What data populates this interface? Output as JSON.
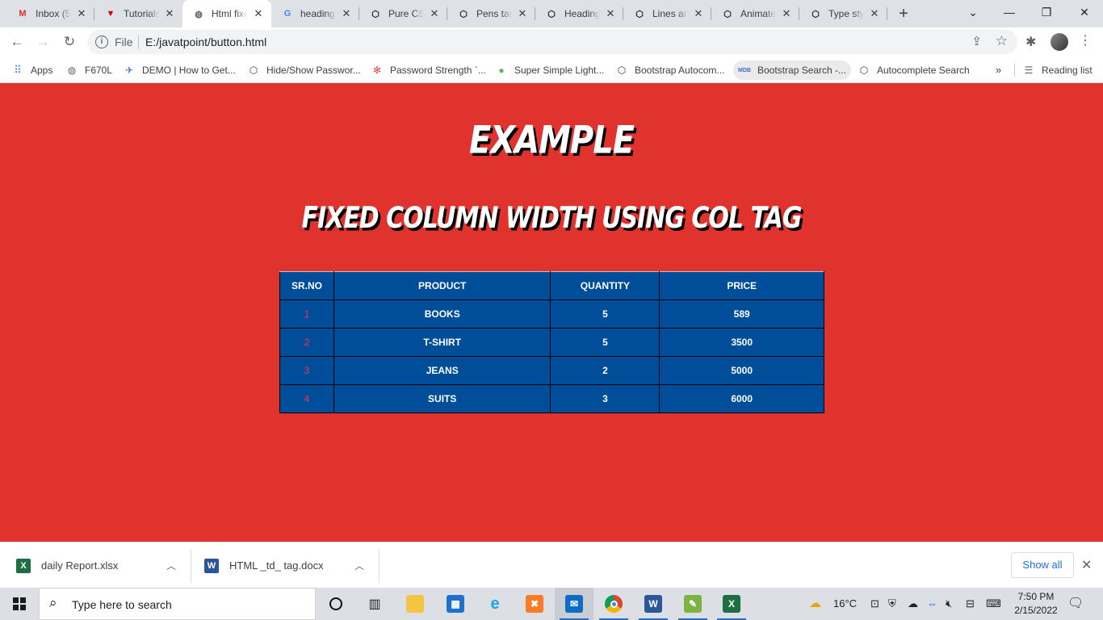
{
  "tabs": [
    {
      "title": "Inbox (5...",
      "icon": "gmail-icon",
      "active": false
    },
    {
      "title": "Tutorials...",
      "icon": "tutorials-icon",
      "active": false
    },
    {
      "title": "Html fixe...",
      "icon": "globe-icon",
      "active": true
    },
    {
      "title": "heading...",
      "icon": "google-icon",
      "active": false
    },
    {
      "title": "Pure CSS...",
      "icon": "codepen-icon",
      "active": false
    },
    {
      "title": "Pens tag...",
      "icon": "codepen-icon",
      "active": false
    },
    {
      "title": "Heading...",
      "icon": "codepen-icon",
      "active": false
    },
    {
      "title": "Lines an...",
      "icon": "codepen-icon",
      "active": false
    },
    {
      "title": "Animate...",
      "icon": "codepen-icon",
      "active": false
    },
    {
      "title": "Type sty...",
      "icon": "codepen-icon",
      "active": false
    }
  ],
  "address": {
    "scheme": "File",
    "url": "E:/javatpoint/button.html"
  },
  "bookmarks": [
    {
      "label": "Apps",
      "icon": "apps-grid-icon"
    },
    {
      "label": "F670L",
      "icon": "globe-icon"
    },
    {
      "label": "DEMO | How to Get...",
      "icon": "bird-icon"
    },
    {
      "label": "Hide/Show Passwor...",
      "icon": "codepen-icon"
    },
    {
      "label": "Password Strength `...",
      "icon": "asterisk-icon"
    },
    {
      "label": "Super Simple Light...",
      "icon": "leaf-icon"
    },
    {
      "label": "Bootstrap Autocom...",
      "icon": "codepen-icon"
    },
    {
      "label": "Bootstrap Search -...",
      "icon": "mdb-icon"
    },
    {
      "label": "Autocomplete Search",
      "icon": "codepen-icon"
    }
  ],
  "bookmarks_more": "»",
  "reading_list": "Reading list",
  "page": {
    "heading": "EXAMPLE",
    "subheading": "FIXED COLUMN WIDTH USING COL TAG",
    "bg_color": "#e0332e",
    "table": {
      "headers": [
        "SR.NO",
        "PRODUCT",
        "QUANTITY",
        "PRICE"
      ],
      "rows": [
        [
          "1",
          "BOOKS",
          "5",
          "589"
        ],
        [
          "2",
          "T-SHIRT",
          "5",
          "3500"
        ],
        [
          "3",
          "JEANS",
          "2",
          "5000"
        ],
        [
          "4",
          "SUITS",
          "3",
          "6000"
        ]
      ]
    }
  },
  "downloads": [
    {
      "name": "daily Report.xlsx",
      "icon": "excel-file-icon"
    },
    {
      "name": "HTML _td_ tag.docx",
      "icon": "word-file-icon"
    }
  ],
  "show_all": "Show all",
  "taskbar": {
    "search_placeholder": "Type here to search",
    "weather": "16°C",
    "time": "7:50 PM",
    "date": "2/15/2022"
  }
}
